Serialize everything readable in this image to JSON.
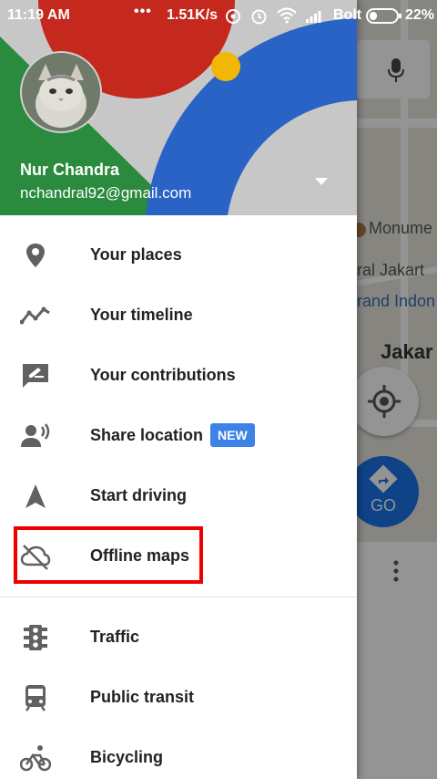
{
  "status_bar": {
    "time": "11:19 AM",
    "dots": "•••",
    "speed": "1.51K/s",
    "carrier": "Bolt",
    "battery": "22%"
  },
  "account": {
    "name": "Nur Chandra",
    "email": "nchandral92@gmail.com"
  },
  "menu": {
    "items": [
      {
        "label": "Your places",
        "icon": "location-pin-icon"
      },
      {
        "label": "Your timeline",
        "icon": "timeline-icon"
      },
      {
        "label": "Your contributions",
        "icon": "contributions-icon"
      },
      {
        "label": "Share location",
        "icon": "share-location-icon",
        "badge": "NEW"
      },
      {
        "label": "Start driving",
        "icon": "navigation-arrow-icon"
      },
      {
        "label": "Offline maps",
        "icon": "cloud-off-icon"
      }
    ],
    "layers": [
      {
        "label": "Traffic",
        "icon": "traffic-light-icon"
      },
      {
        "label": "Public transit",
        "icon": "train-icon"
      },
      {
        "label": "Bicycling",
        "icon": "bicycle-icon"
      }
    ]
  },
  "map": {
    "labels": [
      "Monume",
      "ral Jakart",
      "rand Indon",
      "Jakar"
    ],
    "go_label": "GO"
  },
  "colors": {
    "accent_blue": "#3d82e6",
    "highlight_red": "#ee0000",
    "header_red": "#c5281c",
    "header_green": "#2a8a3e",
    "header_blue": "#2a63c6",
    "header_yellow": "#f2b705"
  }
}
